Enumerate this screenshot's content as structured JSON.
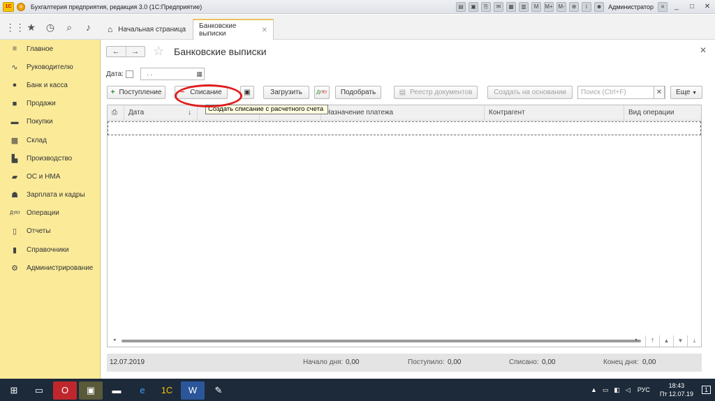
{
  "window": {
    "title": "Бухгалтерия предприятия, редакция 3.0  (1С:Предприятие)",
    "user": "Администратор"
  },
  "tabs": [
    {
      "label": "Начальная страница"
    },
    {
      "label": "Банковские выписки"
    }
  ],
  "sidebar": {
    "items": [
      {
        "label": "Главное",
        "icon": "menu-icon"
      },
      {
        "label": "Руководителю",
        "icon": "chart-line-icon"
      },
      {
        "label": "Банк и касса",
        "icon": "coins-icon"
      },
      {
        "label": "Продажи",
        "icon": "bag-icon"
      },
      {
        "label": "Покупки",
        "icon": "cart-icon"
      },
      {
        "label": "Склад",
        "icon": "warehouse-icon"
      },
      {
        "label": "Производство",
        "icon": "factory-icon"
      },
      {
        "label": "ОС и НМА",
        "icon": "truck-icon"
      },
      {
        "label": "Зарплата и кадры",
        "icon": "person-icon"
      },
      {
        "label": "Операции",
        "icon": "dt-kt-icon"
      },
      {
        "label": "Отчеты",
        "icon": "report-icon"
      },
      {
        "label": "Справочники",
        "icon": "book-icon"
      },
      {
        "label": "Администрирование",
        "icon": "gear-icon"
      }
    ]
  },
  "page": {
    "title": "Банковские выписки",
    "date_label": "Дата:",
    "date_value": ". ."
  },
  "toolbar": {
    "receipt": "Поступление",
    "writeoff": "Списание",
    "load": "Загрузить",
    "pick": "Подобрать",
    "registry": "Реестр документов",
    "create_based": "Создать на основании",
    "search_placeholder": "Поиск (Ctrl+F)",
    "more": "Еще"
  },
  "tooltip": "Создать списание с расчетного счета",
  "table": {
    "columns": [
      "Дата",
      "Назначение платежа",
      "Контрагент",
      "Вид операции"
    ],
    "sort_marker": "↓"
  },
  "footer": {
    "date": "12.07.2019",
    "start_label": "Начало дня:",
    "start": "0,00",
    "in_label": "Поступило:",
    "in": "0,00",
    "out_label": "Списано:",
    "out": "0,00",
    "end_label": "Конец дня:",
    "end": "0,00"
  },
  "taskbar": {
    "lang": "РУС",
    "time": "18:43",
    "date": "Пт 12.07.19",
    "notif": "1"
  },
  "colors": {
    "sidebar": "#fbeb99",
    "annotation": "#e01b1b",
    "tooltip": "#ffffe1"
  }
}
